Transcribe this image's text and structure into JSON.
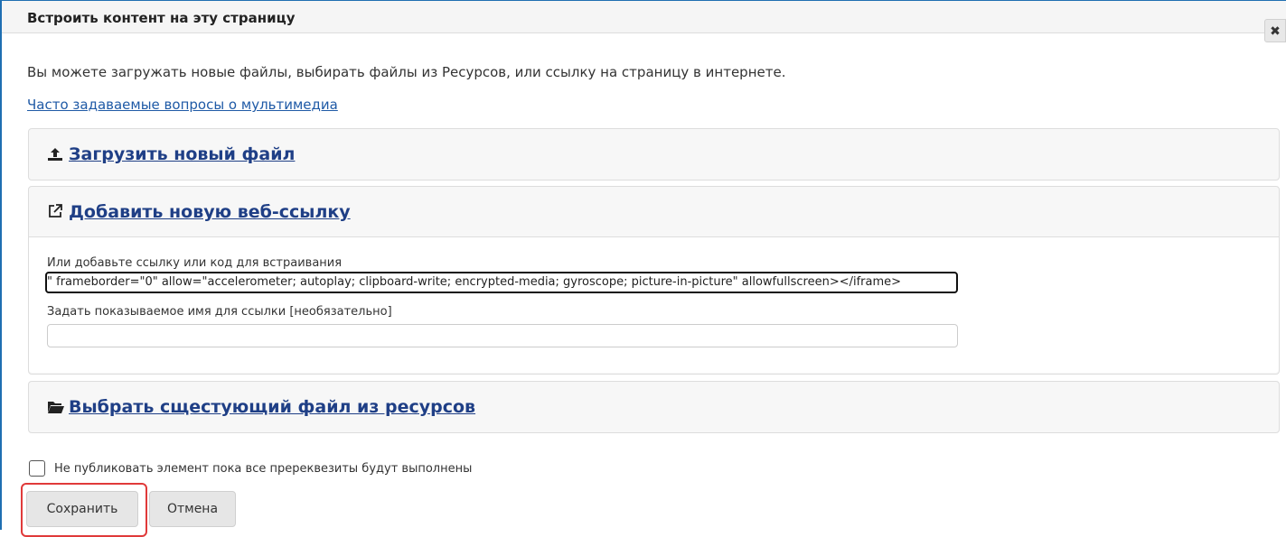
{
  "dialog": {
    "title": "Встроить контент на эту страницу",
    "close_symbol": "✖",
    "intro": "Вы можете загружать новые файлы, выбирать файлы из Ресурсов, или ссылку на страницу в интернете.",
    "faq_link": "Часто задаваемые вопросы о мультимедиа"
  },
  "panels": {
    "upload": {
      "label": "Загрузить новый файл",
      "icon": "upload-icon"
    },
    "web_link": {
      "label": "Добавить новую веб-ссылку",
      "icon": "external-link-icon",
      "embed_label": "Или добавьте ссылку или код для встраивания",
      "embed_value": "\" frameborder=\"0\" allow=\"accelerometer; autoplay; clipboard-write; encrypted-media; gyroscope; picture-in-picture\" allowfullscreen></iframe>",
      "name_label": "Задать показываемое имя для ссылки [необязательно]",
      "name_value": ""
    },
    "resources": {
      "label": "Выбрать сщестующий файл из ресурсов",
      "icon": "folder-open-icon"
    }
  },
  "prerequisites": {
    "label": "Не публиковать элемент пока все пререквезиты будут выполнены",
    "checked": false
  },
  "buttons": {
    "save": "Сохранить",
    "cancel": "Отмена"
  },
  "colors": {
    "link": "#1f3f86",
    "highlight": "#e03a3a",
    "frame": "#1f6fb2"
  }
}
